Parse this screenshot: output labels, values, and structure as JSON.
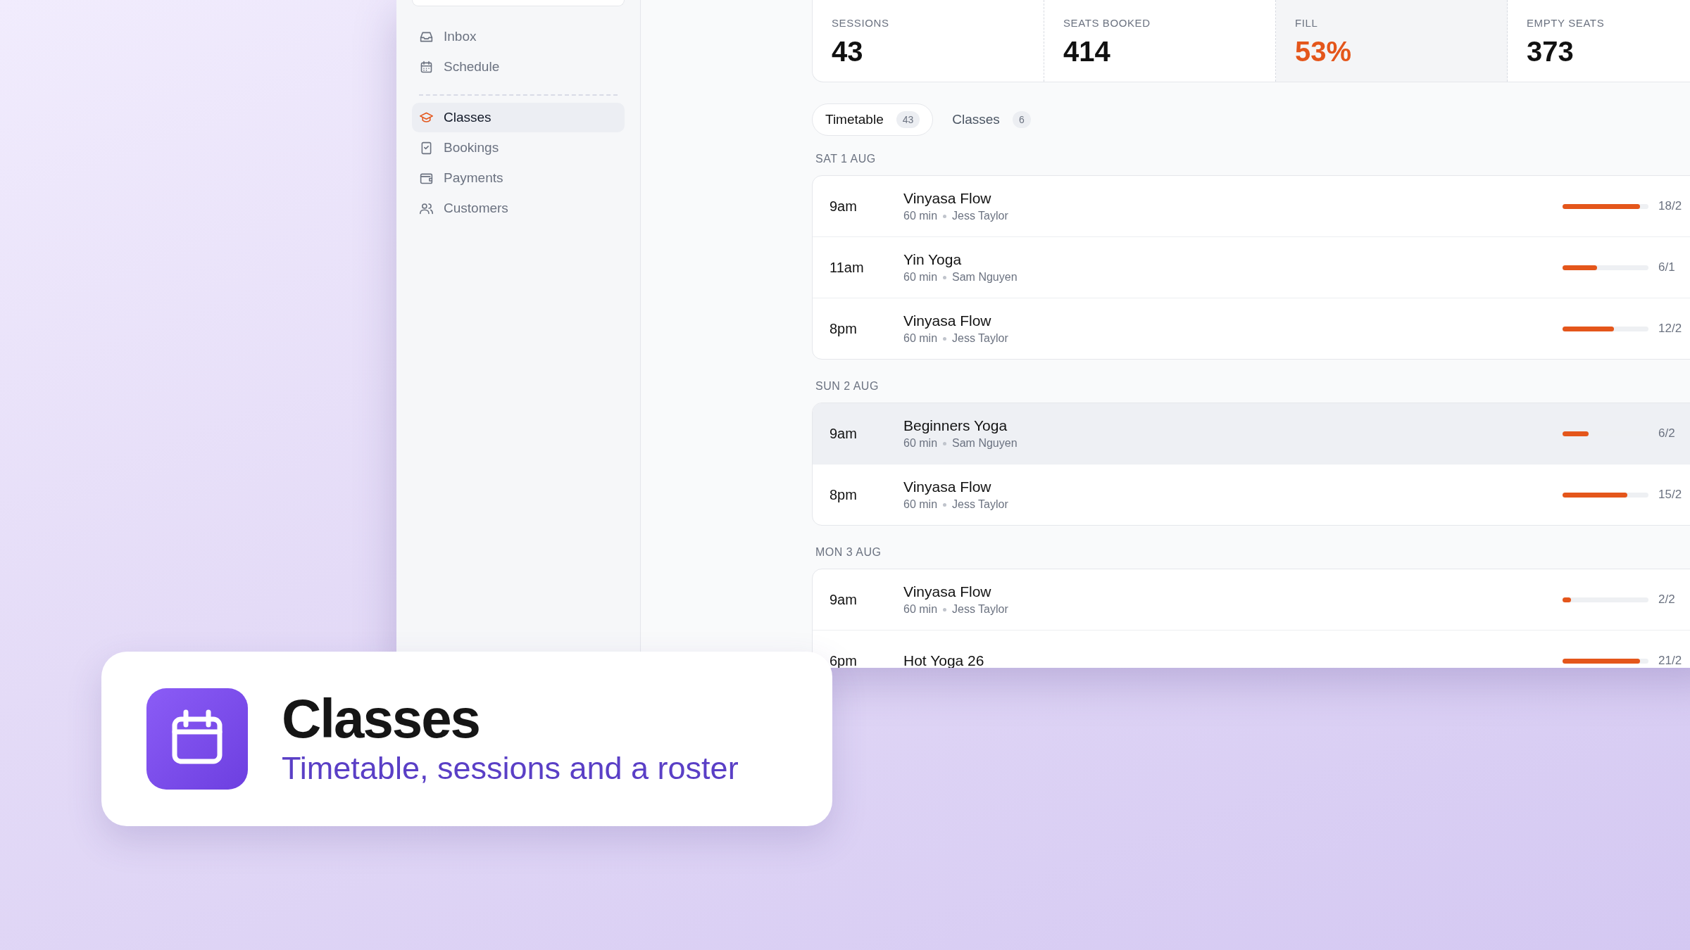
{
  "sidebar": {
    "items": [
      {
        "label": "Inbox",
        "selected": false
      },
      {
        "label": "Schedule",
        "selected": false
      },
      {
        "label": "Classes",
        "selected": true
      },
      {
        "label": "Bookings",
        "selected": false
      },
      {
        "label": "Payments",
        "selected": false
      },
      {
        "label": "Customers",
        "selected": false
      }
    ]
  },
  "stats": [
    {
      "label": "SESSIONS",
      "value": "43",
      "highlighted": false
    },
    {
      "label": "SEATS BOOKED",
      "value": "414",
      "highlighted": false
    },
    {
      "label": "FILL",
      "value": "53%",
      "highlighted": true
    },
    {
      "label": "EMPTY SEATS",
      "value": "373",
      "highlighted": false
    }
  ],
  "tabs": [
    {
      "label": "Timetable",
      "count": "43",
      "selected": true
    },
    {
      "label": "Classes",
      "count": "6",
      "selected": false
    }
  ],
  "days": [
    {
      "date": "SAT 1 AUG",
      "sessions": [
        {
          "time": "9am",
          "title": "Vinyasa Flow",
          "duration": "60 min",
          "teacher": "Jess Taylor",
          "level": 0.9,
          "booked": "18/2",
          "highlighted": false
        },
        {
          "time": "11am",
          "title": "Yin Yoga",
          "duration": "60 min",
          "teacher": "Sam Nguyen",
          "level": 0.4,
          "booked": "6/1",
          "highlighted": false
        },
        {
          "time": "8pm",
          "title": "Vinyasa Flow",
          "duration": "60 min",
          "teacher": "Jess Taylor",
          "level": 0.6,
          "booked": "12/2",
          "highlighted": false
        }
      ]
    },
    {
      "date": "SUN 2 AUG",
      "sessions": [
        {
          "time": "9am",
          "title": "Beginners Yoga",
          "duration": "60 min",
          "teacher": "Sam Nguyen",
          "level": 0.3,
          "booked": "6/2",
          "highlighted": true
        },
        {
          "time": "8pm",
          "title": "Vinyasa Flow",
          "duration": "60 min",
          "teacher": "Jess Taylor",
          "level": 0.75,
          "booked": "15/2",
          "highlighted": false
        }
      ]
    },
    {
      "date": "MON 3 AUG",
      "sessions": [
        {
          "time": "9am",
          "title": "Vinyasa Flow",
          "duration": "60 min",
          "teacher": "Jess Taylor",
          "level": 0.1,
          "booked": "2/2",
          "highlighted": false
        },
        {
          "time": "6pm",
          "title": "Hot Yoga 26",
          "level": 0.9,
          "booked": "21/2",
          "highlighted": false
        }
      ]
    }
  ],
  "callout": {
    "title": "Classes",
    "subtitle": "Timetable, sessions and a roster"
  }
}
